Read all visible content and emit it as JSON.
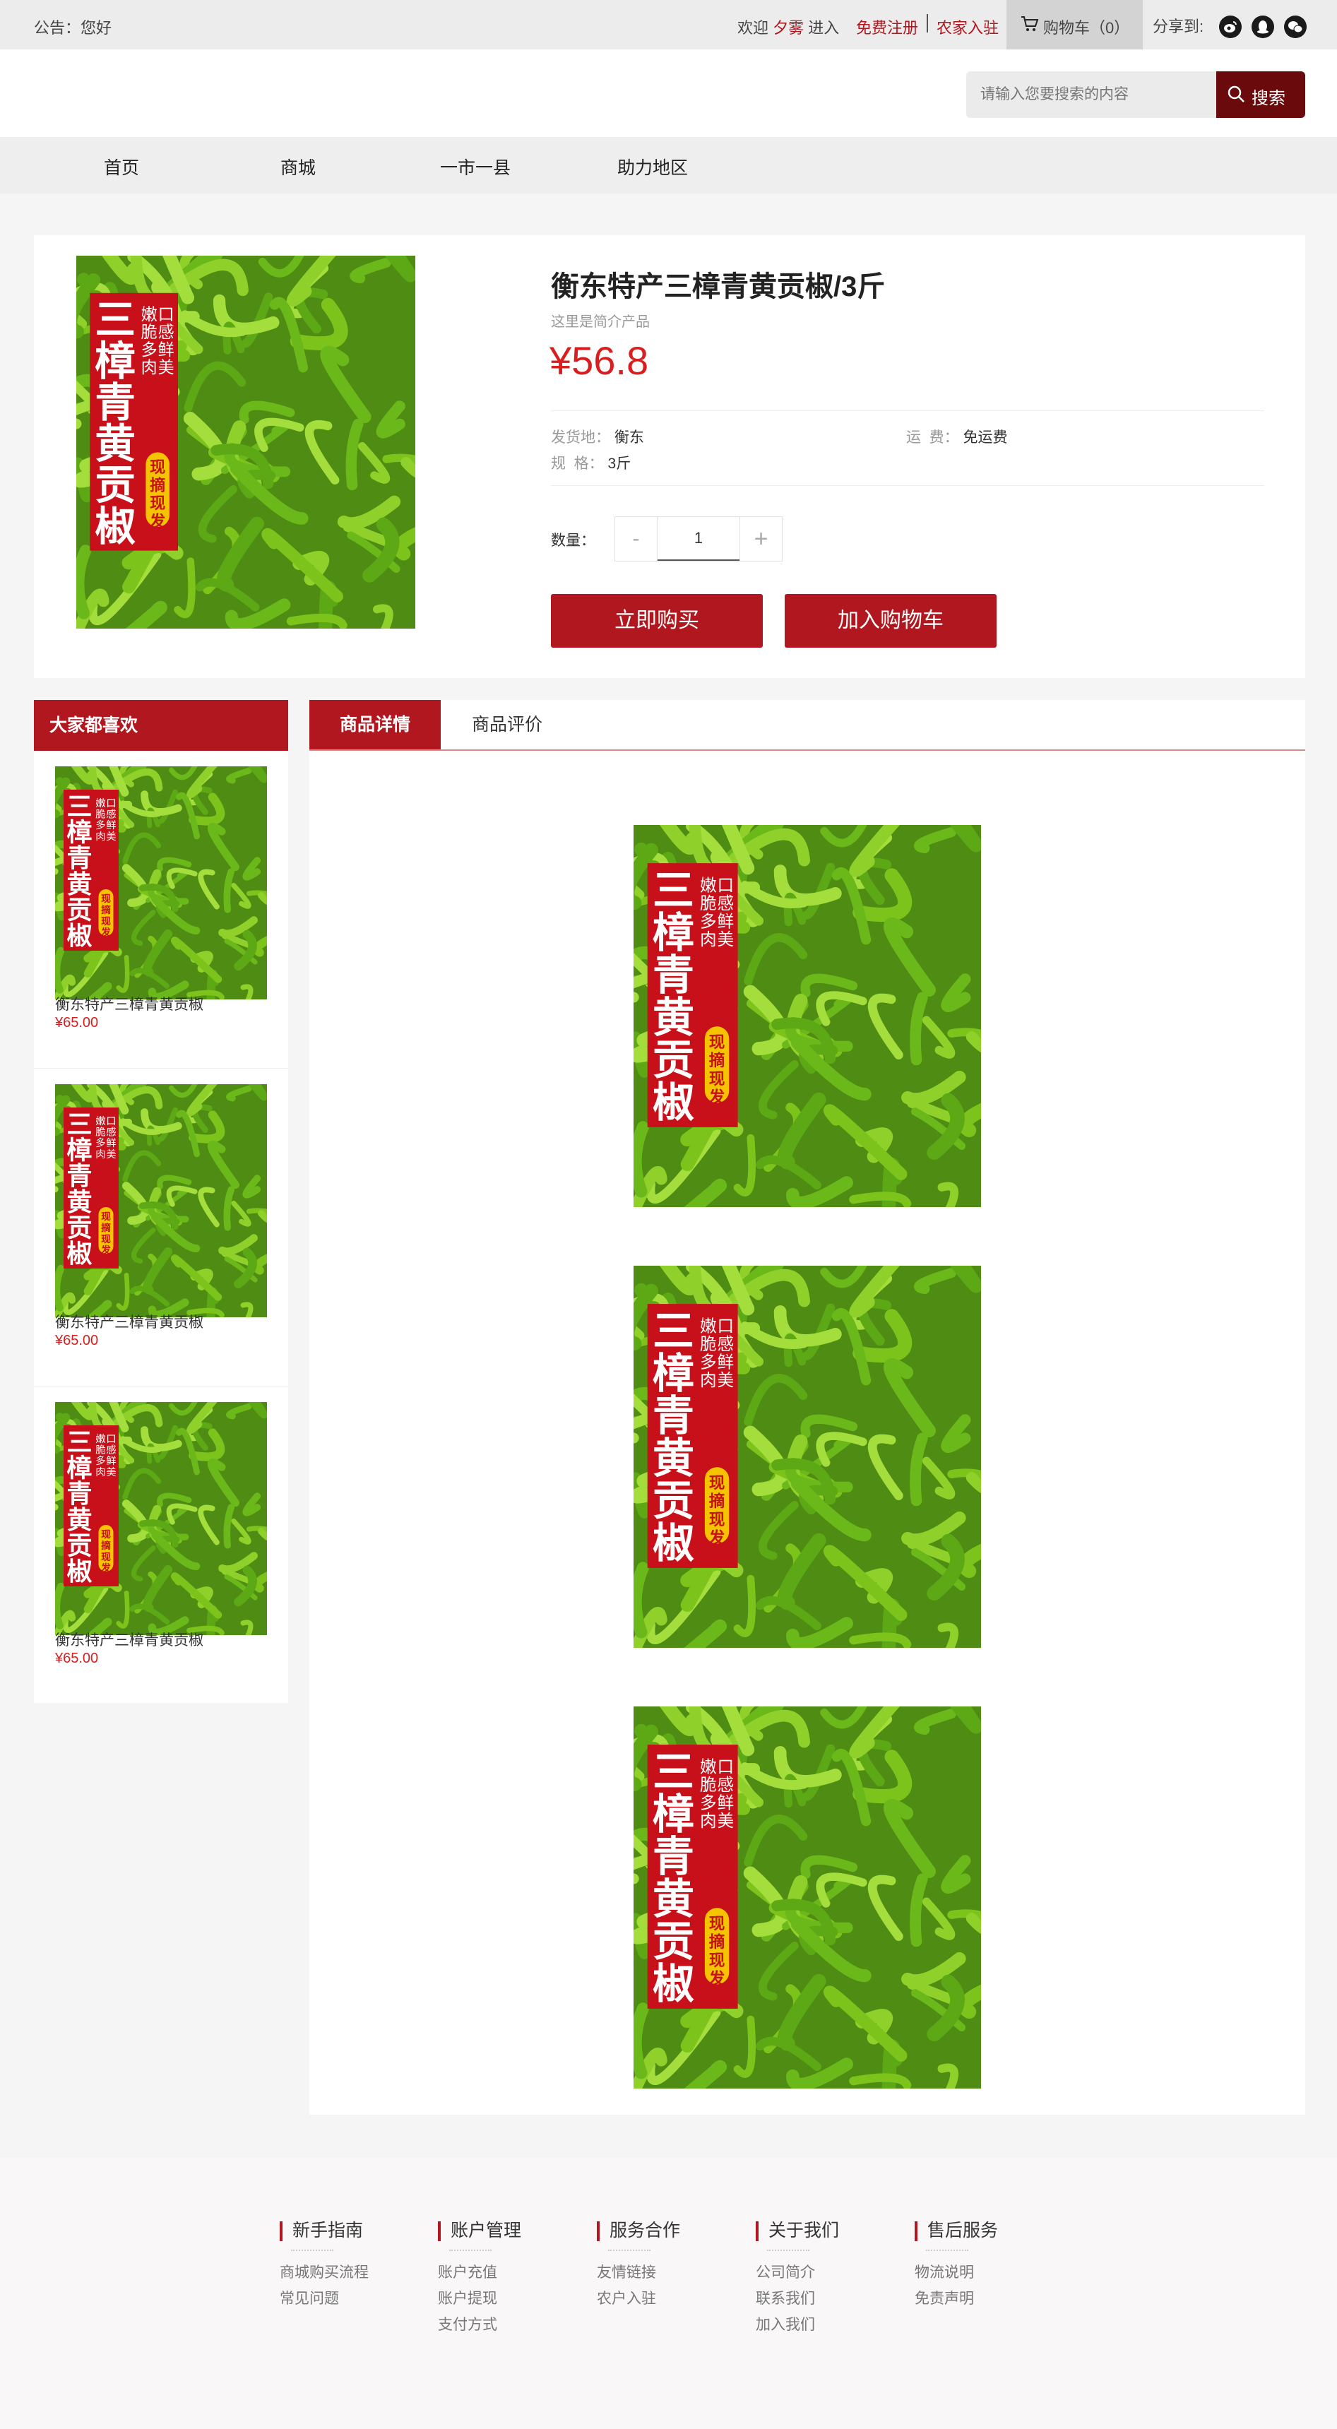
{
  "topbar": {
    "notice": "公告：您好",
    "welcome_prefix": "欢迎",
    "username": "夕雾",
    "welcome_suffix": "进入",
    "register": "免费注册",
    "farmer_join": "农家入驻",
    "cart_label": "购物车（0）",
    "share_label": "分享到:",
    "share_icons": [
      "weibo-icon",
      "qq-icon",
      "wechat-icon"
    ]
  },
  "search": {
    "placeholder": "请输入您要搜索的内容",
    "button": "搜索"
  },
  "nav": {
    "items": [
      "首页",
      "商城",
      "一市一县",
      "助力地区"
    ]
  },
  "product": {
    "title": "衡东特产三樟青黄贡椒/3斤",
    "subtitle": "这里是简介产品",
    "price": "¥56.8",
    "origin_label": "发货地：",
    "origin_value": "衡东",
    "shipping_label": "运  费：",
    "shipping_value": "免运费",
    "spec_label": "规  格：",
    "spec_value": "3斤",
    "quantity_label": "数量：",
    "quantity_value": "1",
    "minus": "-",
    "plus": "+",
    "buy_now": "立即购买",
    "add_to_cart": "加入购物车",
    "image": {
      "big_text": "三樟青黄贡椒",
      "slogan": "嫩脆多肉口感鲜美",
      "badge": "现摘现发"
    }
  },
  "sidebar": {
    "title": "大家都喜欢",
    "items": [
      {
        "name": "衡东特产三樟青黄贡椒",
        "price": "¥65.00"
      },
      {
        "name": "衡东特产三樟青黄贡椒",
        "price": "¥65.00"
      },
      {
        "name": "衡东特产三樟青黄贡椒",
        "price": "¥65.00"
      }
    ]
  },
  "tabs": {
    "detail": "商品详情",
    "reviews": "商品评价"
  },
  "footer": {
    "columns": [
      {
        "title": "新手指南",
        "links": [
          "商城购买流程",
          "常见问题"
        ]
      },
      {
        "title": "账户管理",
        "links": [
          "账户充值",
          "账户提现",
          "支付方式"
        ]
      },
      {
        "title": "服务合作",
        "links": [
          "友情链接",
          "农户入驻"
        ]
      },
      {
        "title": "关于我们",
        "links": [
          "公司简介",
          "联系我们",
          "加入我们"
        ]
      },
      {
        "title": "售后服务",
        "links": [
          "物流说明",
          "免责声明"
        ]
      }
    ]
  },
  "colors": {
    "brand_red": "#b0171f",
    "price_red": "#d81e1e",
    "search_button": "#6a0a0d"
  }
}
